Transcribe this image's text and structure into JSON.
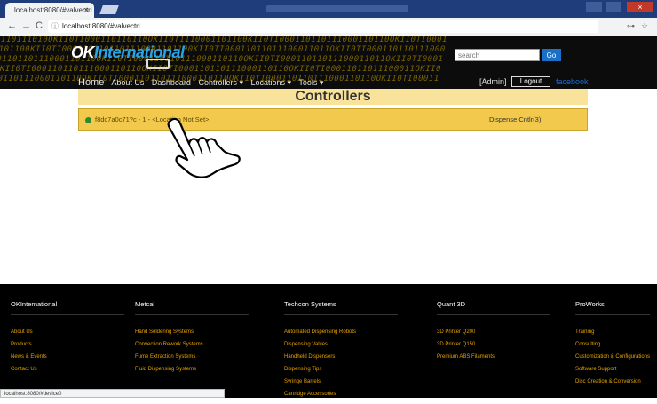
{
  "browser": {
    "tab_title": "localhost:8080/#valvectrl",
    "tab_close": "×",
    "back": "←",
    "forward": "→",
    "reload": "C",
    "info": "ⓘ",
    "url": "localhost:8080/#valvectrl",
    "key_glyph": "⊶",
    "star_glyph": "☆",
    "status_url": "localhost:8080/#device0"
  },
  "site": {
    "logo_ok": "OK",
    "logo_intl": "International",
    "search_placeholder": "search",
    "search_button": "Go",
    "binary_lines": [
      "0110111010OKII0TI000110110110OKII0T1110001101100KII0TI000110110111000110110OKII0TI0001",
      "1101100KII0TI0001101101101110001101100KII0TI00011011011100011011OKII0TI000110110111000",
      "10110110111000110110OKII0TI000110110111000110110OKII0TI00011011011100011011OKII0TI0001",
      "0OKII0TI000110110111000110110OKII0TI000110110111000110110OKII0TI00011011011100011OKII0",
      "110110111000110110OKII0TI000110110111000110110OKII0TI000110110111000110110OKII0TI00011"
    ],
    "nav": {
      "home": "Home",
      "about": "About Us",
      "dashboard": "Dashboard",
      "controllers": "Controllers ▾",
      "locations": "Locations ▾",
      "tools": "Tools ▾",
      "admin": "[Admin]",
      "logout": "Logout",
      "facebook": "facebook"
    }
  },
  "main": {
    "title": "Controllers",
    "device_link": "f8dc7a0c71?c - 1 - <Location Not Set>",
    "device_type": "Dispense Cntlr(3)"
  },
  "footer": {
    "columns": [
      {
        "title": "OKInternational",
        "items": [
          "About Us",
          "Products",
          "News & Events",
          "Contact Us"
        ]
      },
      {
        "title": "Metcal",
        "items": [
          "Hand Soldering Systems",
          "Convection Rework Systems",
          "Fume Extraction Systems",
          "Fluid Dispensing Systems"
        ]
      },
      {
        "title": "Techcon Systems",
        "items": [
          "Automated Dispensing Robots",
          "Dispensing Valves",
          "Handheld Dispensers",
          "Dispensing Tips",
          "Syringe Barrels",
          "Cartridge Accessories"
        ]
      },
      {
        "title": "Quant 3D",
        "items": [
          "3D Printer Q200",
          "3D Printer Q150",
          "Premium ABS Filaments"
        ]
      },
      {
        "title": "ProWorks",
        "items": [
          "Training",
          "Consulting",
          "Customization & Configurations",
          "Software Support",
          "Disc Creation & Conversion"
        ]
      }
    ]
  },
  "colors": {
    "banner_text": "#7a6400",
    "device_row": "#f2c94c",
    "header_bar": "#f9e39b",
    "footer_link": "#e5a300",
    "accent": "#1a6fc9"
  }
}
